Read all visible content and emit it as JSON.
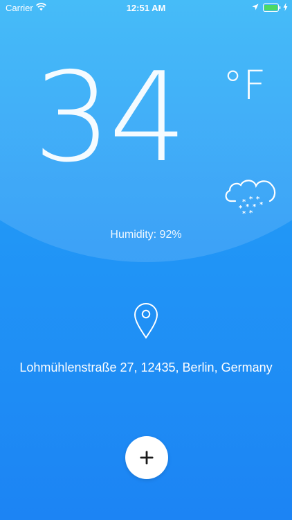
{
  "status_bar": {
    "carrier": "Carrier",
    "time": "12:51 AM",
    "icons": [
      "wifi-icon",
      "location-arrow-icon",
      "battery-icon",
      "charging-icon"
    ],
    "battery_color": "#4cd964"
  },
  "weather": {
    "temperature": "34",
    "unit": "°F",
    "condition_icon": "snow-cloud-icon",
    "humidity": "Humidity: 92%"
  },
  "location": {
    "icon": "map-pin-icon",
    "address": "Lohmühlenstraße 27, 12435, Berlin, Germany"
  },
  "actions": {
    "add_icon": "plus-icon"
  },
  "colors": {
    "background_top": "#2bb2f7",
    "background_bottom": "#1c84f4",
    "foreground": "#ffffff"
  }
}
